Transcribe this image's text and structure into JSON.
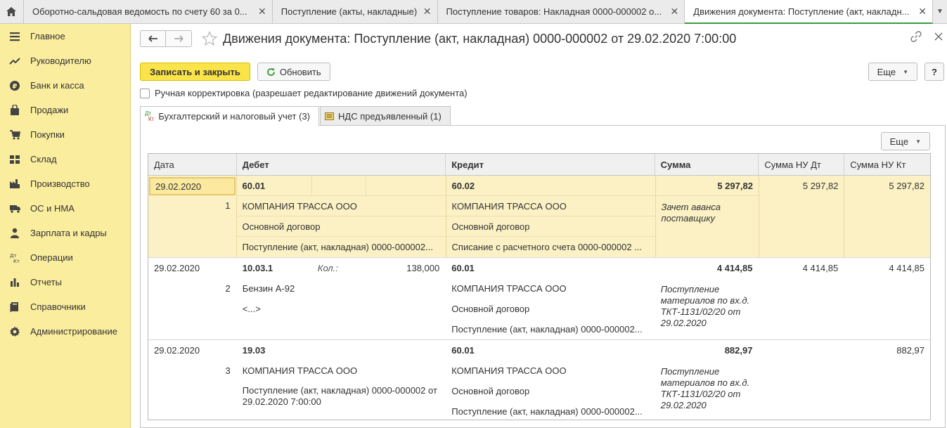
{
  "window_tabs": [
    {
      "label": "Оборотно-сальдовая ведомость по счету 60 за 0..."
    },
    {
      "label": "Поступление (акты, накладные)"
    },
    {
      "label": "Поступление товаров: Накладная 0000-000002 о..."
    },
    {
      "label": "Движения документа: Поступление (акт, накладн..."
    }
  ],
  "sidebar": {
    "items": [
      {
        "label": "Главное",
        "icon": "menu-icon"
      },
      {
        "label": "Руководителю",
        "icon": "trend-icon"
      },
      {
        "label": "Банк и касса",
        "icon": "ruble-icon"
      },
      {
        "label": "Продажи",
        "icon": "bag-icon"
      },
      {
        "label": "Покупки",
        "icon": "cart-icon"
      },
      {
        "label": "Склад",
        "icon": "warehouse-icon"
      },
      {
        "label": "Производство",
        "icon": "factory-icon"
      },
      {
        "label": "ОС и НМА",
        "icon": "truck-icon"
      },
      {
        "label": "Зарплата и кадры",
        "icon": "person-icon"
      },
      {
        "label": "Операции",
        "icon": "dt-kt-icon"
      },
      {
        "label": "Отчеты",
        "icon": "bar-chart-icon"
      },
      {
        "label": "Справочники",
        "icon": "books-icon"
      },
      {
        "label": "Администрирование",
        "icon": "gear-icon"
      }
    ]
  },
  "header": {
    "title": "Движения документа: Поступление (акт, накладная) 0000-000002 от 29.02.2020 7:00:00"
  },
  "toolbar": {
    "save_close": "Записать и закрыть",
    "refresh": "Обновить",
    "more": "Еще",
    "help": "?"
  },
  "manual_edit_label": "Ручная корректировка (разрешает редактирование движений документа)",
  "doc_tabs": [
    {
      "label": "Бухгалтерский и налоговый учет (3)",
      "icon_top": "Дт",
      "icon_bottom": "Кт"
    },
    {
      "label": "НДС предъявленный (1)"
    }
  ],
  "panel_more": "Еще",
  "table": {
    "headers": {
      "date": "Дата",
      "debit": "Дебет",
      "credit": "Кредит",
      "sum": "Сумма",
      "nu_dt": "Сумма НУ Дт",
      "nu_kt": "Сумма НУ Кт"
    },
    "rows": [
      {
        "date": "29.02.2020",
        "no": "1",
        "debit_account": "60.01",
        "debit_lines": [
          "КОМПАНИЯ ТРАССА ООО",
          "Основной договор",
          "Поступление (акт, накладная) 0000-000002..."
        ],
        "credit_account": "60.02",
        "credit_lines": [
          "КОМПАНИЯ ТРАССА ООО",
          "Основной договор",
          "Списание с расчетного счета 0000-000002 ..."
        ],
        "sum": "5 297,82",
        "comment": "Зачет аванса поставщику",
        "nu_dt": "5 297,82",
        "nu_kt": "5 297,82"
      },
      {
        "date": "29.02.2020",
        "no": "2",
        "debit_account": "10.03.1",
        "qty_label": "Кол.:",
        "qty": "138,000",
        "debit_lines": [
          "Бензин А-92",
          "<...>"
        ],
        "credit_account": "60.01",
        "credit_lines": [
          "КОМПАНИЯ ТРАССА ООО",
          "Основной договор",
          "Поступление (акт, накладная) 0000-000002..."
        ],
        "sum": "4 414,85",
        "comment": "Поступление материалов по вх.д. ТКТ-1131/02/20 от 29.02.2020",
        "nu_dt": "4 414,85",
        "nu_kt": "4 414,85"
      },
      {
        "date": "29.02.2020",
        "no": "3",
        "debit_account": "19.03",
        "debit_lines": [
          "КОМПАНИЯ ТРАССА ООО",
          "Поступление (акт, накладная) 0000-000002 от 29.02.2020 7:00:00"
        ],
        "credit_account": "60.01",
        "credit_lines": [
          "КОМПАНИЯ ТРАССА ООО",
          "Основной договор",
          "Поступление (акт, накладная) 0000-000002..."
        ],
        "sum": "882,97",
        "comment": "Поступление материалов по вх.д. ТКТ-1131/02/20 от 29.02.2020",
        "nu_dt": "",
        "nu_kt": "882,97"
      }
    ]
  }
}
